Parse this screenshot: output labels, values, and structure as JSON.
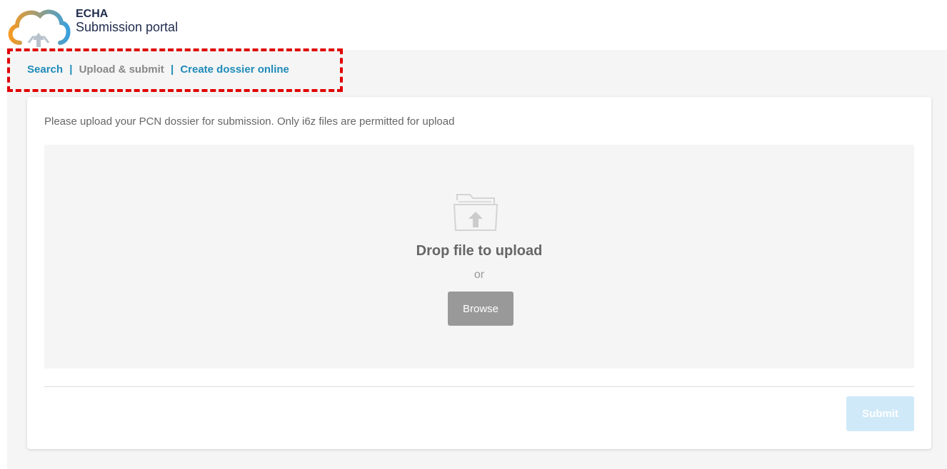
{
  "header": {
    "logo_icon": "cloud-upload-icon",
    "logo_line1": "ECHA",
    "logo_line2": "Submission portal"
  },
  "nav": {
    "search_label": "Search",
    "separator": "|",
    "upload_label": "Upload & submit",
    "create_label": "Create dossier online"
  },
  "card": {
    "instructions": "Please upload your PCN dossier for submission. Only i6z files are permitted for upload",
    "dropzone": {
      "icon": "folder-upload-icon",
      "drop_text": "Drop file to upload",
      "or_text": "or",
      "browse_label": "Browse"
    },
    "submit_label": "Submit"
  },
  "colors": {
    "link": "#1f8bb8",
    "highlight": "#e00000",
    "submit_disabled": "#cfe9f8",
    "browse": "#999999"
  }
}
